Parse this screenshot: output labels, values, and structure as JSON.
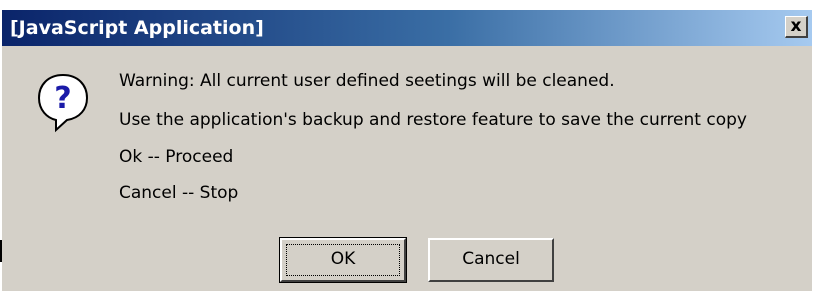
{
  "window": {
    "title": "[JavaScript Application]",
    "close_label": "x"
  },
  "message": {
    "line1": "Warning: All current user defined seetings will be cleaned.",
    "line2": "Use the application's backup and restore feature to save the current copy",
    "line3": "Ok -- Proceed",
    "line4": "Cancel -- Stop"
  },
  "buttons": {
    "ok_label": "OK",
    "cancel_label": "Cancel"
  },
  "icons": {
    "dialog_icon": "question-icon"
  },
  "colors": {
    "titlebar_start": "#0a246a",
    "titlebar_end": "#a6caf0",
    "dialog_bg": "#d4d0c8",
    "icon_blue": "#1a1aa8"
  }
}
